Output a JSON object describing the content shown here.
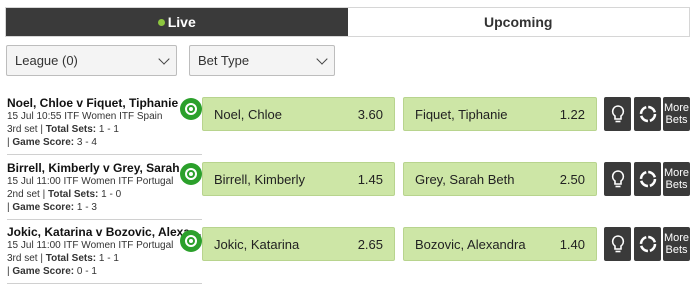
{
  "tabs": [
    {
      "label": "Live",
      "active": true
    },
    {
      "label": "Upcoming",
      "active": false
    }
  ],
  "filters": {
    "league": "League (0)",
    "bet_type": "Bet Type"
  },
  "events": [
    {
      "title": "Noel, Chloe v Fiquet, Tiphanie",
      "datetime": "15 Jul 10:55",
      "competition": "ITF Women ITF Spain",
      "set": "3rd set",
      "total_sets_label": "Total Sets:",
      "total_sets": "1 - 1",
      "game_score_label": "Game Score:",
      "game_score": "3 - 4",
      "home": {
        "name": "Noel, Chloe",
        "odds": "3.60"
      },
      "away": {
        "name": "Fiquet, Tiphanie",
        "odds": "1.22"
      },
      "more_label_1": "More",
      "more_label_2": "Bets"
    },
    {
      "title": "Birrell, Kimberly v Grey, Sarah Beth",
      "datetime": "15 Jul 11:00",
      "competition": "ITF Women ITF Portugal",
      "set": "2nd set",
      "total_sets_label": "Total Sets:",
      "total_sets": "1 - 0",
      "game_score_label": "Game Score:",
      "game_score": "1 - 3",
      "home": {
        "name": "Birrell, Kimberly",
        "odds": "1.45"
      },
      "away": {
        "name": "Grey, Sarah Beth",
        "odds": "2.50"
      },
      "more_label_1": "More",
      "more_label_2": "Bets"
    },
    {
      "title": "Jokic, Katarina v Bozovic, Alexandra",
      "datetime": "15 Jul 11:00",
      "competition": "ITF Women ITF Portugal",
      "set": "3rd set",
      "total_sets_label": "Total Sets:",
      "total_sets": "1 - 1",
      "game_score_label": "Game Score:",
      "game_score": "0 - 1",
      "home": {
        "name": "Jokic, Katarina",
        "odds": "2.65"
      },
      "away": {
        "name": "Bozovic, Alexandra",
        "odds": "1.40"
      },
      "more_label_1": "More",
      "more_label_2": "Bets"
    }
  ],
  "icons": {
    "live_dot": "live-dot-icon",
    "stream": "live-stream-icon",
    "tip": "lightbulb-icon",
    "stats": "stats-ring-icon",
    "dropdown": "chevron-down-icon"
  },
  "colors": {
    "tab_active_bg": "#3a3a3a",
    "live_green": "#8dc63f",
    "odds_bg": "#cde6a6",
    "stream_green": "#2ba02b"
  }
}
